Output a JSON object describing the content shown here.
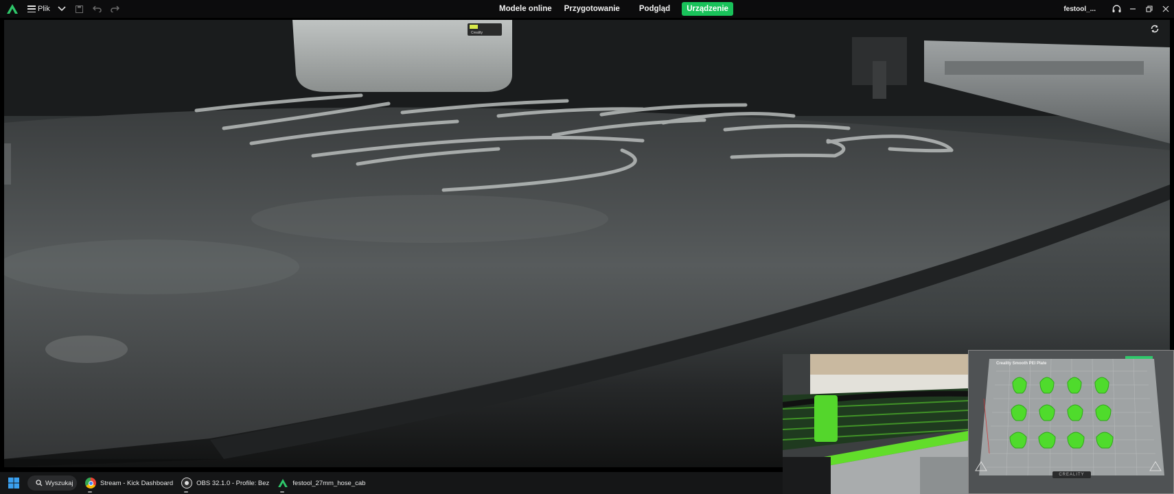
{
  "app": {
    "menu_label": "Plik",
    "tabs": [
      {
        "label": "Modele online",
        "active": false
      },
      {
        "label": "Przygotowanie",
        "active": false
      },
      {
        "label": "Podgląd",
        "active": false
      },
      {
        "label": "Urządzenie",
        "active": true
      }
    ],
    "project_name": "festool_...",
    "accent_color": "#19c25a"
  },
  "icons": {
    "logo": "creality-print-logo-icon",
    "menu": "hamburger-menu-icon",
    "dropdown": "chevron-down-icon",
    "save": "save-icon",
    "undo": "undo-icon",
    "redo": "redo-icon",
    "support": "headset-icon",
    "minimize": "minimize-icon",
    "maximize": "restore-icon",
    "close": "close-icon",
    "camera_refresh": "refresh-icon"
  },
  "camera": {
    "label_on_toolhead": "Creality"
  },
  "overlay": {
    "slicer_plate_label": "Creality Smooth PEI Plate",
    "slicer_brand": "CREALITY"
  },
  "taskbar": {
    "search_label": "Wyszukaj",
    "items": [
      {
        "label": "Stream - Kick Dashboard",
        "icon": "chrome-icon"
      },
      {
        "label": "OBS 32.1.0 - Profile: Bez",
        "icon": "obs-icon"
      },
      {
        "label": "festool_27mm_hose_cab",
        "icon": "creality-print-icon"
      }
    ]
  }
}
